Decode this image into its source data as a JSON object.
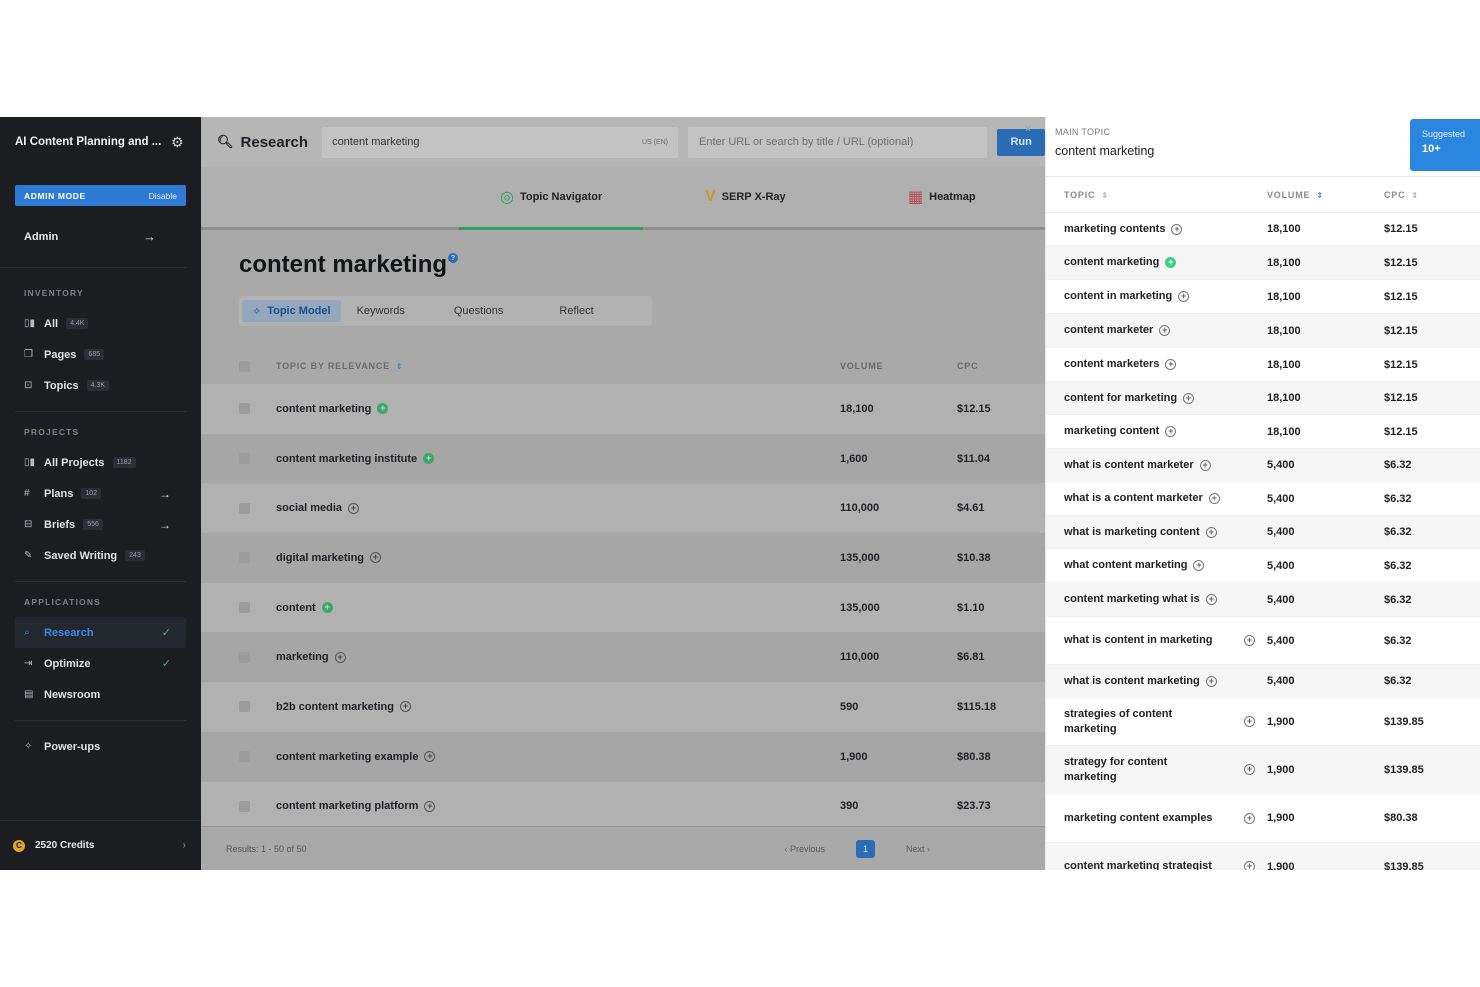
{
  "sidebar": {
    "app_title": "AI Content Planning and ...",
    "admin_mode_label": "ADMIN MODE",
    "admin_mode_action": "Disable",
    "admin_label": "Admin",
    "inventory_heading": "INVENTORY",
    "inventory": [
      {
        "label": "All",
        "count": "4.4K",
        "icon": "grid-icon"
      },
      {
        "label": "Pages",
        "count": "685",
        "icon": "pages-icon"
      },
      {
        "label": "Topics",
        "count": "4.3K",
        "icon": "topics-icon"
      }
    ],
    "projects_heading": "PROJECTS",
    "projects": [
      {
        "label": "All Projects",
        "count": "1182"
      },
      {
        "label": "Plans",
        "count": "102"
      },
      {
        "label": "Briefs",
        "count": "556"
      },
      {
        "label": "Saved Writing",
        "count": "243"
      }
    ],
    "applications_heading": "APPLICATIONS",
    "applications": [
      {
        "label": "Research"
      },
      {
        "label": "Optimize"
      },
      {
        "label": "Newsroom"
      }
    ],
    "powerups": "Power-ups",
    "credits": "2520 Credits",
    "credits_coin": "C"
  },
  "topbar": {
    "title": "Research",
    "search_value": "content marketing",
    "locale": "US (EN)",
    "url_placeholder": "Enter URL or search by title / URL (optional)",
    "run_label": "Run"
  },
  "navtabs": [
    {
      "label": "Topic Navigator"
    },
    {
      "label": "SERP X-Ray"
    },
    {
      "label": "Heatmap"
    }
  ],
  "main": {
    "heading": "content marketing",
    "help_glyph": "?",
    "subtabs": [
      "Topic Model",
      "Keywords",
      "Questions",
      "Reflect"
    ],
    "columns": {
      "topic": "TOPIC BY RELEVANCE",
      "volume": "VOLUME",
      "cpc": "CPC"
    },
    "rows": [
      {
        "topic": "content marketing",
        "volume": "18,100",
        "cpc": "$12.15",
        "added": true
      },
      {
        "topic": "content marketing institute",
        "volume": "1,600",
        "cpc": "$11.04",
        "added": true
      },
      {
        "topic": "social media",
        "volume": "110,000",
        "cpc": "$4.61",
        "added": false
      },
      {
        "topic": "digital marketing",
        "volume": "135,000",
        "cpc": "$10.38",
        "added": false
      },
      {
        "topic": "content",
        "volume": "135,000",
        "cpc": "$1.10",
        "added": true
      },
      {
        "topic": "marketing",
        "volume": "110,000",
        "cpc": "$6.81",
        "added": false
      },
      {
        "topic": "b2b content marketing",
        "volume": "590",
        "cpc": "$115.18",
        "added": false
      },
      {
        "topic": "content marketing example",
        "volume": "1,900",
        "cpc": "$80.38",
        "added": false
      },
      {
        "topic": "content marketing platform",
        "volume": "390",
        "cpc": "$23.73",
        "added": false
      }
    ],
    "results": "Results: 1 - 50 of 50",
    "prev": "Previous",
    "next": "Next",
    "page": "1"
  },
  "panel": {
    "main_topic_label": "MAIN TOPIC",
    "main_topic_value": "content marketing",
    "suggested_label": "Suggested",
    "suggested_count": "10+",
    "columns": {
      "topic": "TOPIC",
      "volume": "VOLUME",
      "cpc": "CPC"
    },
    "rows": [
      {
        "topic": "marketing contents",
        "volume": "18,100",
        "cpc": "$12.15",
        "added": false
      },
      {
        "topic": "content marketing",
        "volume": "18,100",
        "cpc": "$12.15",
        "added": true
      },
      {
        "topic": "content in marketing",
        "volume": "18,100",
        "cpc": "$12.15",
        "added": false
      },
      {
        "topic": "content marketer",
        "volume": "18,100",
        "cpc": "$12.15",
        "added": false
      },
      {
        "topic": "content marketers",
        "volume": "18,100",
        "cpc": "$12.15",
        "added": false
      },
      {
        "topic": "content for marketing",
        "volume": "18,100",
        "cpc": "$12.15",
        "added": false
      },
      {
        "topic": "marketing content",
        "volume": "18,100",
        "cpc": "$12.15",
        "added": false
      },
      {
        "topic": "what is content marketer",
        "volume": "5,400",
        "cpc": "$6.32",
        "added": false
      },
      {
        "topic": "what is a content marketer",
        "volume": "5,400",
        "cpc": "$6.32",
        "added": false
      },
      {
        "topic": "what is marketing content",
        "volume": "5,400",
        "cpc": "$6.32",
        "added": false
      },
      {
        "topic": "what content marketing",
        "volume": "5,400",
        "cpc": "$6.32",
        "added": false
      },
      {
        "topic": "content marketing what is",
        "volume": "5,400",
        "cpc": "$6.32",
        "added": false
      },
      {
        "topic": "what is content in marketing",
        "volume": "5,400",
        "cpc": "$6.32",
        "added": false,
        "wrap": true
      },
      {
        "topic": "what is content marketing",
        "volume": "5,400",
        "cpc": "$6.32",
        "added": false
      },
      {
        "topic": "strategies of content marketing",
        "volume": "1,900",
        "cpc": "$139.85",
        "added": false,
        "wrap": true
      },
      {
        "topic": "strategy for content marketing",
        "volume": "1,900",
        "cpc": "$139.85",
        "added": false,
        "wrap": true
      },
      {
        "topic": "marketing content examples",
        "volume": "1,900",
        "cpc": "$80.38",
        "added": false,
        "wrap": true
      },
      {
        "topic": "content marketing strategist",
        "volume": "1,900",
        "cpc": "$139.85",
        "added": false,
        "wrap": true
      }
    ]
  }
}
